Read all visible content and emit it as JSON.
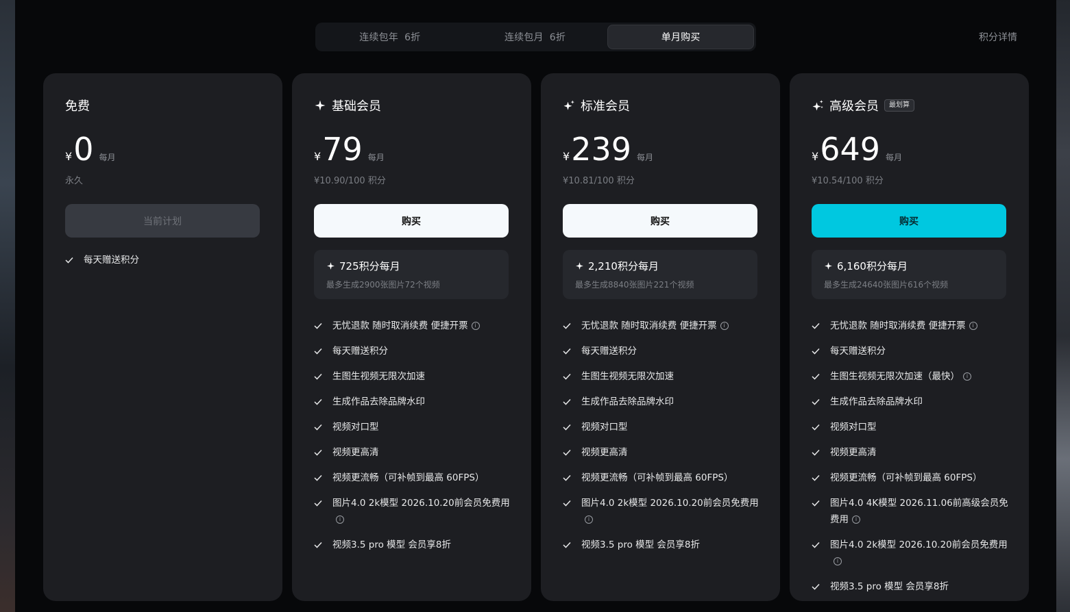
{
  "tabs": [
    {
      "label": "连续包年",
      "discount": "6折"
    },
    {
      "label": "连续包月",
      "discount": "6折"
    },
    {
      "label": "单月购买",
      "discount": ""
    }
  ],
  "points_detail": "积分详情",
  "plans": [
    {
      "title": "免费",
      "currency": "¥",
      "price": "0",
      "period": "每月",
      "subprice": "永久",
      "button": "当前计划",
      "features": [
        "每天赠送积分"
      ]
    },
    {
      "title": "基础会员",
      "currency": "¥",
      "price": "79",
      "period": "每月",
      "subprice": "¥10.90/100 积分",
      "button": "购买",
      "credits": "725积分每月",
      "credits_sub": "最多生成2900张图片72个视频",
      "features": [
        "无忧退款 随时取消续费 便捷开票",
        "每天赠送积分",
        "生图生视频无限次加速",
        "生成作品去除品牌水印",
        "视频对口型",
        "视频更高清",
        "视频更流畅（可补帧到最高 60FPS）",
        "图片4.0 2k模型 2026.10.20前会员免费用",
        "视频3.5 pro 模型 会员享8折"
      ]
    },
    {
      "title": "标准会员",
      "currency": "¥",
      "price": "239",
      "period": "每月",
      "subprice": "¥10.81/100 积分",
      "button": "购买",
      "credits": "2,210积分每月",
      "credits_sub": "最多生成8840张图片221个视频",
      "features": [
        "无忧退款 随时取消续费 便捷开票",
        "每天赠送积分",
        "生图生视频无限次加速",
        "生成作品去除品牌水印",
        "视频对口型",
        "视频更高清",
        "视频更流畅（可补帧到最高 60FPS）",
        "图片4.0 2k模型 2026.10.20前会员免费用",
        "视频3.5 pro 模型 会员享8折"
      ]
    },
    {
      "title": "高级会员",
      "badge": "最划算",
      "currency": "¥",
      "price": "649",
      "period": "每月",
      "subprice": "¥10.54/100 积分",
      "button": "购买",
      "credits": "6,160积分每月",
      "credits_sub": "最多生成24640张图片616个视频",
      "features": [
        "无忧退款 随时取消续费 便捷开票",
        "每天赠送积分",
        "生图生视频无限次加速（最快）",
        "生成作品去除品牌水印",
        "视频对口型",
        "视频更高清",
        "视频更流畅（可补帧到最高 60FPS）",
        "图片4.0 4K模型 2026.11.06前高级会员免费用",
        "图片4.0 2k模型 2026.10.20前会员免费用",
        "视频3.5 pro 模型 会员享8折"
      ]
    }
  ],
  "colors": {
    "accent": "#00c8e0",
    "card_bg": "#1d1e22",
    "page_bg": "#07080a"
  }
}
